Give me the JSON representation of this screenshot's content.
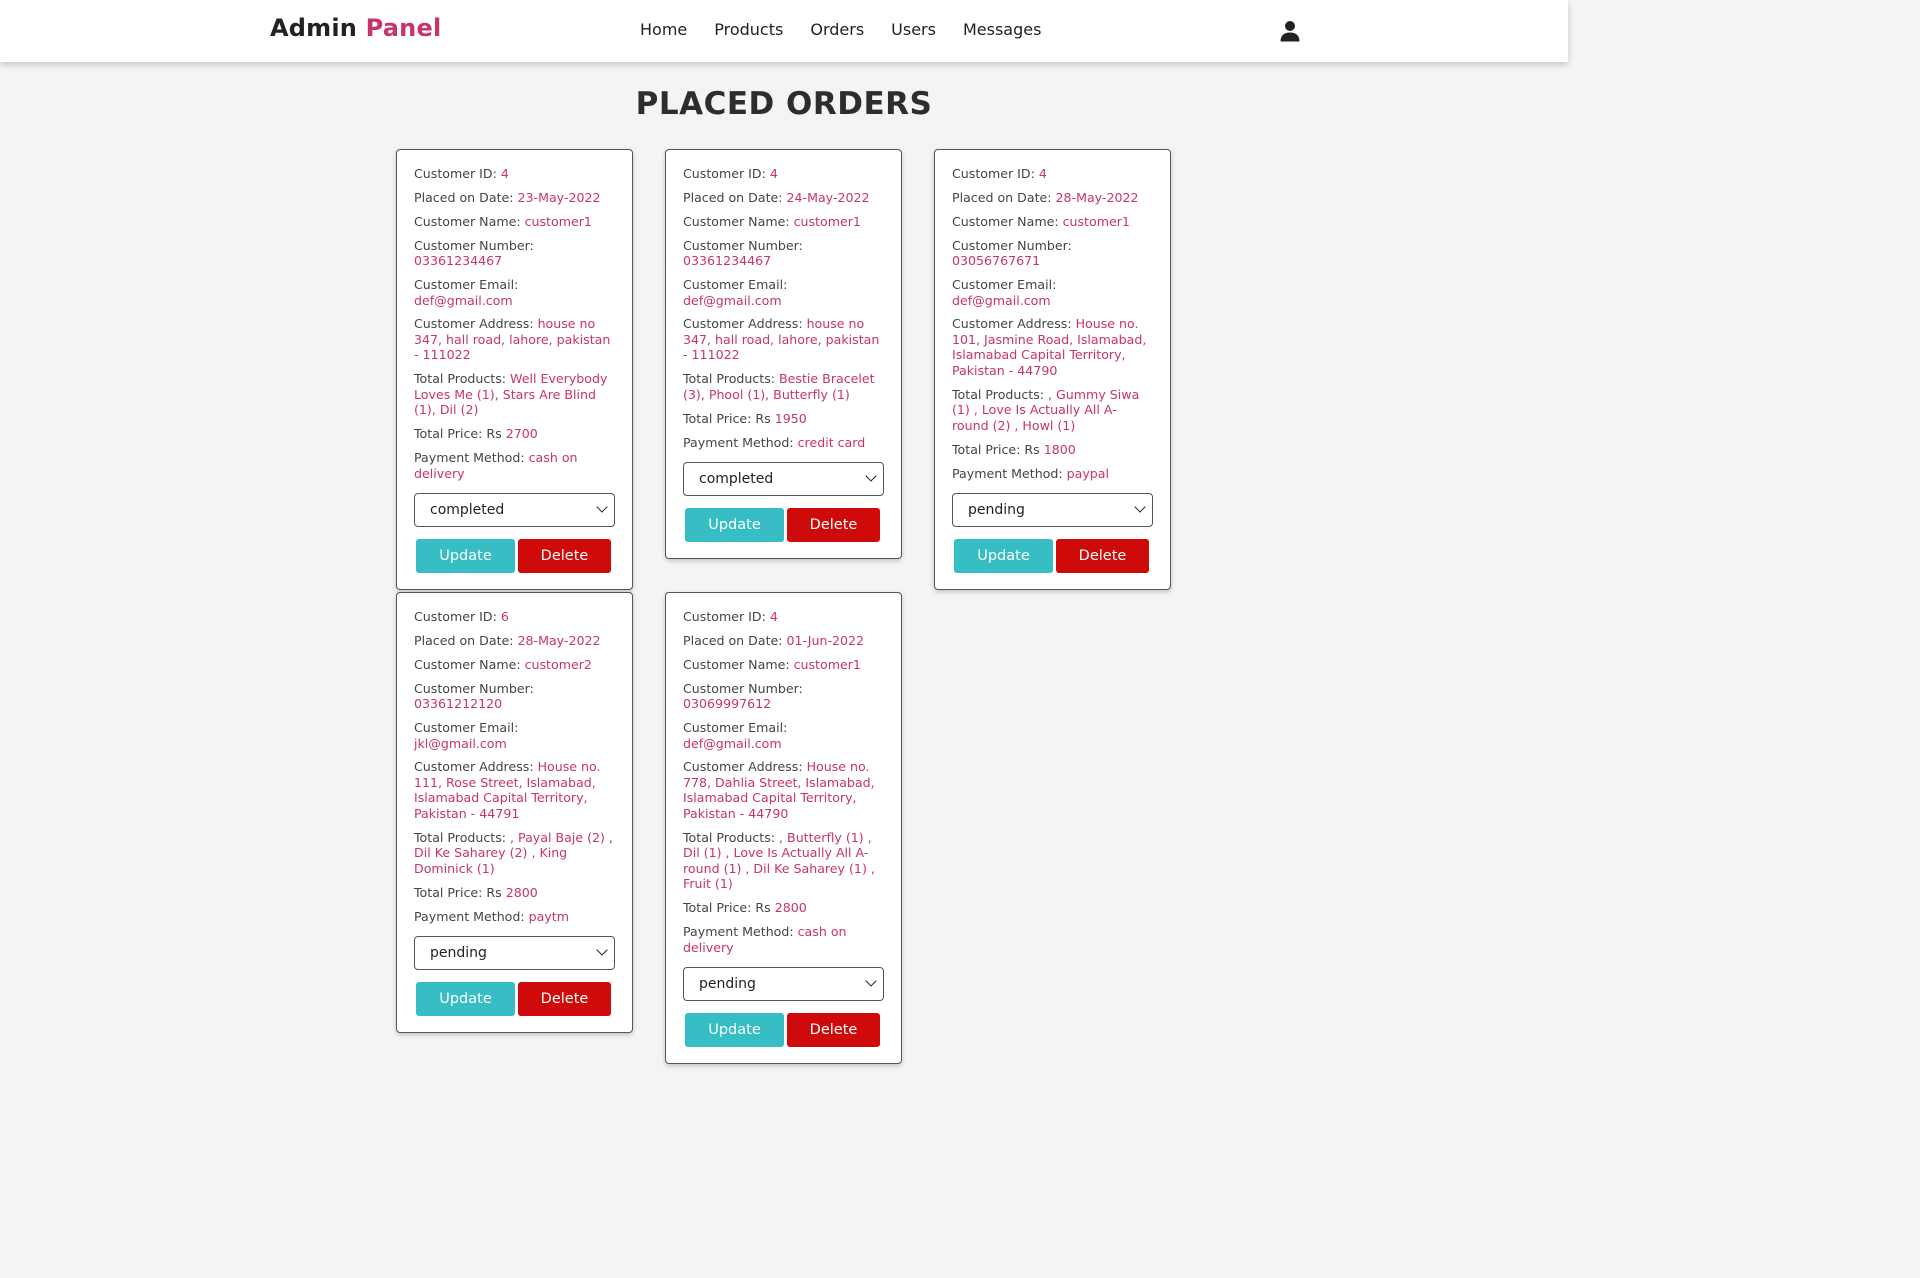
{
  "header": {
    "logo_main": "Admin",
    "logo_accent": "Panel",
    "nav": [
      "Home",
      "Products",
      "Orders",
      "Users",
      "Messages"
    ],
    "user_icon": "user-icon"
  },
  "page": {
    "title": "PLACED ORDERS"
  },
  "labels": {
    "customer_id": "Customer ID: ",
    "placed_on": "Placed on Date: ",
    "name": "Customer Name: ",
    "number": "Customer Number: ",
    "email": "Customer Email: ",
    "address": "Customer Address: ",
    "products": "Total Products: ",
    "price": "Total Price: Rs ",
    "payment": "Payment Method: ",
    "update": "Update",
    "delete": "Delete"
  },
  "colors": {
    "accent": "#c8336d",
    "update": "#36bec4",
    "delete": "#cf0a0a"
  },
  "orders": [
    {
      "customer_id": "4",
      "date": "23-May-2022",
      "name": "customer1",
      "number": "03361234467",
      "email": "def@gmail.com",
      "address": "house no 347, hall road, lahore, pakistan - 111022",
      "products": "Well Everybody Loves Me (1), Stars Are Blind (1), Dil (2)",
      "price": "2700",
      "payment": "cash on delivery",
      "status": "completed"
    },
    {
      "customer_id": "4",
      "date": "24-May-2022",
      "name": "customer1",
      "number": "03361234467",
      "email": "def@gmail.com",
      "address": "house no 347, hall road, lahore, pakistan - 111022",
      "products": "Bestie Bracelet (3), Phool (1), Butterfly (1)",
      "price": "1950",
      "payment": "credit card",
      "status": "completed"
    },
    {
      "customer_id": "4",
      "date": "28-May-2022",
      "name": "customer1",
      "number": "03056767671",
      "email": "def@gmail.com",
      "address": "House no. 101, Jasmine Road, Islamabad, Islamabad Capital Territory, Pakistan - 44790",
      "products": ", Gummy Siwa (1) , Love Is Actually All A-round (2) , Howl (1)",
      "price": "1800",
      "payment": "paypal",
      "status": "pending"
    },
    {
      "customer_id": "6",
      "date": "28-May-2022",
      "name": "customer2",
      "number": "03361212120",
      "email": "jkl@gmail.com",
      "address": "House no. 111, Rose Street, Islamabad, Islamabad Capital Territory, Pakistan - 44791",
      "products": ", Payal Baje (2) , Dil Ke Saharey (2) , King Dominick (1)",
      "price": "2800",
      "payment": "paytm",
      "status": "pending"
    },
    {
      "customer_id": "4",
      "date": "01-Jun-2022",
      "name": "customer1",
      "number": "03069997612",
      "email": "def@gmail.com",
      "address": "House no. 778, Dahlia Street, Islamabad, Islamabad Capital Territory, Pakistan - 44790",
      "products": ", Butterfly (1) , Dil (1) , Love Is Actually All A-round (1) , Dil Ke Saharey (1) , Fruit (1)",
      "price": "2800",
      "payment": "cash on delivery",
      "status": "pending"
    }
  ]
}
